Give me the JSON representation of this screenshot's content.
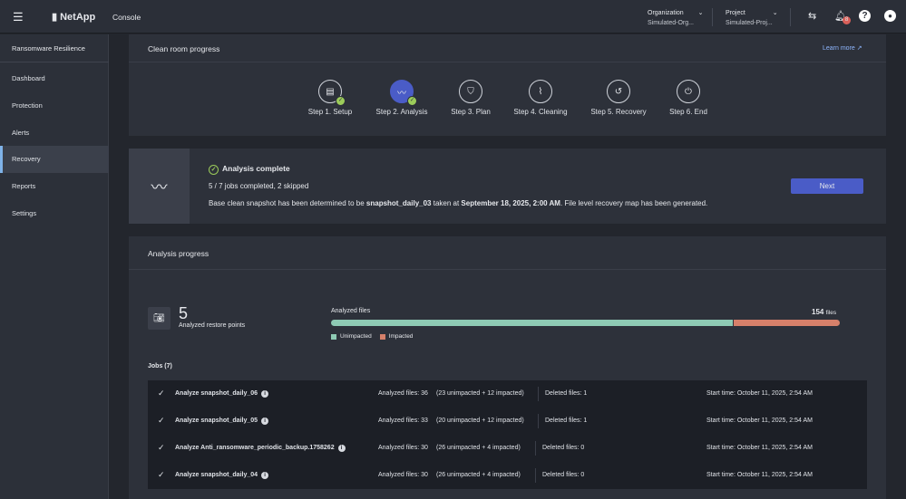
{
  "header": {
    "brand": "NetApp",
    "app": "Console",
    "org_label": "Organization",
    "org_value": "Simulated-Org...",
    "project_label": "Project",
    "project_value": "Simulated-Proj...",
    "notification_count": "8"
  },
  "sidebar": {
    "title": "Ransomware Resilience",
    "items": [
      {
        "label": "Dashboard"
      },
      {
        "label": "Protection"
      },
      {
        "label": "Alerts"
      },
      {
        "label": "Recovery",
        "active": true
      },
      {
        "label": "Reports"
      },
      {
        "label": "Settings"
      }
    ]
  },
  "progress": {
    "title": "Clean room progress",
    "learn_more": "Learn more",
    "steps": [
      {
        "label": "Step 1. Setup",
        "done": true
      },
      {
        "label": "Step 2. Analysis",
        "done": true,
        "active": true
      },
      {
        "label": "Step 3. Plan"
      },
      {
        "label": "Step 4. Cleaning"
      },
      {
        "label": "Step 5. Recovery"
      },
      {
        "label": "Step 6. End"
      }
    ]
  },
  "status": {
    "title": "Analysis complete",
    "jobs": "5 / 7 jobs completed, 2 skipped",
    "msg_pre": "Base clean snapshot has been determined to be ",
    "snapshot": "snapshot_daily_03",
    "msg_mid": " taken at ",
    "date": "September 18, 2025, 2:00 AM",
    "msg_post": ". File level recovery map has been generated.",
    "next": "Next"
  },
  "analysis": {
    "title": "Analysis progress",
    "restore_points": "5",
    "restore_label": "Analyzed restore points",
    "files_label": "Analyzed files",
    "files_total": "154",
    "files_unit": "files",
    "unimpacted_fraction": 0.79,
    "legend_unimpacted": "Unimpacted",
    "legend_impacted": "Impacted",
    "colors": {
      "unimpacted": "#8ecab4",
      "impacted": "#d6806a",
      "accent": "#4a5cc7"
    },
    "jobs_title": "Jobs (7)",
    "jobs": [
      {
        "name": "Analyze snapshot_daily_06",
        "files": "Analyzed files: 36",
        "breakdown": "(23 unimpacted + 12 impacted)",
        "deleted": "Deleted files: 1",
        "start": "Start time: October 11, 2025, 2:54 AM"
      },
      {
        "name": "Analyze snapshot_daily_05",
        "files": "Analyzed files: 33",
        "breakdown": "(20 unimpacted + 12 impacted)",
        "deleted": "Deleted files: 1",
        "start": "Start time: October 11, 2025, 2:54 AM"
      },
      {
        "name": "Analyze Anti_ransomware_periodic_backup.1758262",
        "files": "Analyzed files: 30",
        "breakdown": "(26 unimpacted + 4 impacted)",
        "deleted": "Deleted files: 0",
        "start": "Start time: October 11, 2025, 2:54 AM"
      },
      {
        "name": "Analyze snapshot_daily_04",
        "files": "Analyzed files: 30",
        "breakdown": "(26 unimpacted + 4 impacted)",
        "deleted": "Deleted files: 0",
        "start": "Start time: October 11, 2025, 2:54 AM"
      }
    ]
  }
}
